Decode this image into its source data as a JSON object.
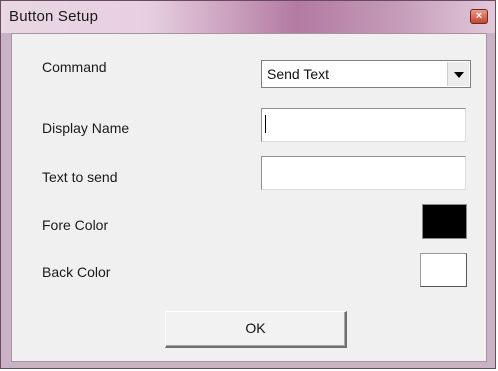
{
  "window": {
    "title": "Button Setup",
    "close_glyph": "×"
  },
  "form": {
    "command": {
      "label": "Command",
      "value": "Send Text"
    },
    "display_name": {
      "label": "Display Name",
      "value": ""
    },
    "text_to_send": {
      "label": "Text to send",
      "value": ""
    },
    "fore_color": {
      "label": "Fore Color",
      "color": "#000000"
    },
    "back_color": {
      "label": "Back Color",
      "color": "#ffffff"
    }
  },
  "buttons": {
    "ok_label": "OK"
  },
  "icons": {
    "close": "close-icon",
    "dropdown": "chevron-down-icon"
  }
}
